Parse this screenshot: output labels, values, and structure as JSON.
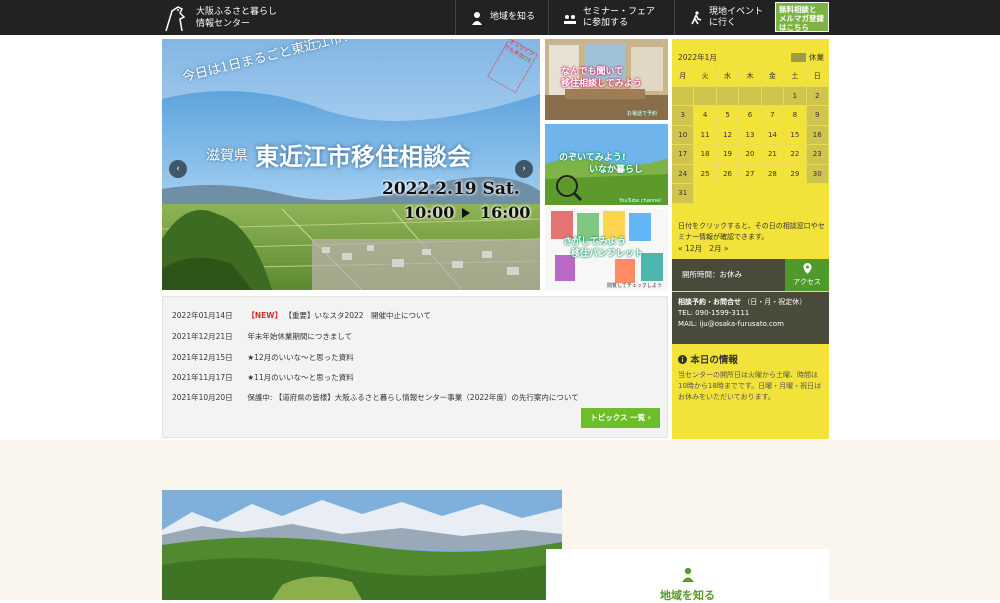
{
  "header": {
    "logo_line1": "大阪ふるさと暮らし",
    "logo_line2": "情報センター",
    "nav": [
      {
        "label": "地域を知る"
      },
      {
        "label1": "セミナー・フェア",
        "label2": "に参加する"
      },
      {
        "label1": "現地イベント",
        "label2": "に行く"
      }
    ],
    "cta_line1": "無料相談と",
    "cta_line2": "メルマガ登録",
    "cta_line3": "はこちら"
  },
  "slider": {
    "tagline": "今日は1日まるごと東近江市！！",
    "prefecture": "滋賀県",
    "title": "東近江市移住相談会",
    "date": "2022.2.19 Sat.",
    "time_start": "10:00",
    "time_end": "16:00",
    "stamp": "オンラインでも参加OK",
    "prev": "‹",
    "next": "›"
  },
  "thumbs": [
    {
      "line1": "なんでも聞いて",
      "line2": "移住相談してみよう",
      "caption": "お電話で予約"
    },
    {
      "line1": "のぞいてみよう!",
      "line2": "いなか暮らし",
      "caption": "YouTube channel"
    },
    {
      "line1": "さがしてみよう",
      "line2": "移住パンフレット",
      "caption": "閲覧してチェックしよう"
    }
  ],
  "news": {
    "items": [
      {
        "date": "2022年01月14日",
        "badge": "【NEW】",
        "text": "【重要】いなスタ2022　開催中止について"
      },
      {
        "date": "2021年12月21日",
        "badge": "",
        "text": "年末年始休業期間につきまして"
      },
      {
        "date": "2021年12月15日",
        "badge": "",
        "text": "★12月のいいな～と思った資料"
      },
      {
        "date": "2021年11月17日",
        "badge": "",
        "text": "★11月のいいな～と思った資料"
      },
      {
        "date": "2021年10月20日",
        "badge": "",
        "text": "保護中: 【道府県の皆様】大阪ふるさと暮らし情報センター事業（2022年度）の先行案内について"
      }
    ],
    "more_label": "トピックス 一覧 ›"
  },
  "calendar": {
    "month": "2022年1月",
    "legend": "休業",
    "weekdays": [
      "月",
      "火",
      "水",
      "木",
      "金",
      "土",
      "日"
    ],
    "weeks": [
      [
        "",
        "",
        "",
        "",
        "",
        "1",
        "2"
      ],
      [
        "3",
        "4",
        "5",
        "6",
        "7",
        "8",
        "9"
      ],
      [
        "10",
        "11",
        "12",
        "13",
        "14",
        "15",
        "16"
      ],
      [
        "17",
        "18",
        "19",
        "20",
        "21",
        "22",
        "23"
      ],
      [
        "24",
        "25",
        "26",
        "27",
        "28",
        "29",
        "30"
      ],
      [
        "31",
        "",
        "",
        "",
        "",
        "",
        ""
      ]
    ],
    "prev_month": "« 12月",
    "next_month": "2月 »",
    "note": "日付をクリックすると、その日の相談窓口やセミナー情報が確認できます。"
  },
  "hours": {
    "label": "開所時間：お休み",
    "access": "アクセス"
  },
  "contact": {
    "title": "相談予約・お問合せ",
    "hours": "（日・月・祝定休）",
    "tel": "TEL: 090-1599-3111",
    "mail": "MAIL: iju@osaka-furusato.com"
  },
  "today": {
    "title": "本日の情報",
    "text": "当センターの開所日は火曜から土曜、時間は10時から18時までです。日曜・月曜・祝日はお休みをいただいております。"
  },
  "section": {
    "title": "地域を知る"
  },
  "colors": {
    "header_bg": "#222222",
    "sidebar_bg": "#f2e23a",
    "accent_green": "#6dbf2a",
    "holiday_cell": "#cfc54c",
    "news_badge": "#d32f2f"
  }
}
